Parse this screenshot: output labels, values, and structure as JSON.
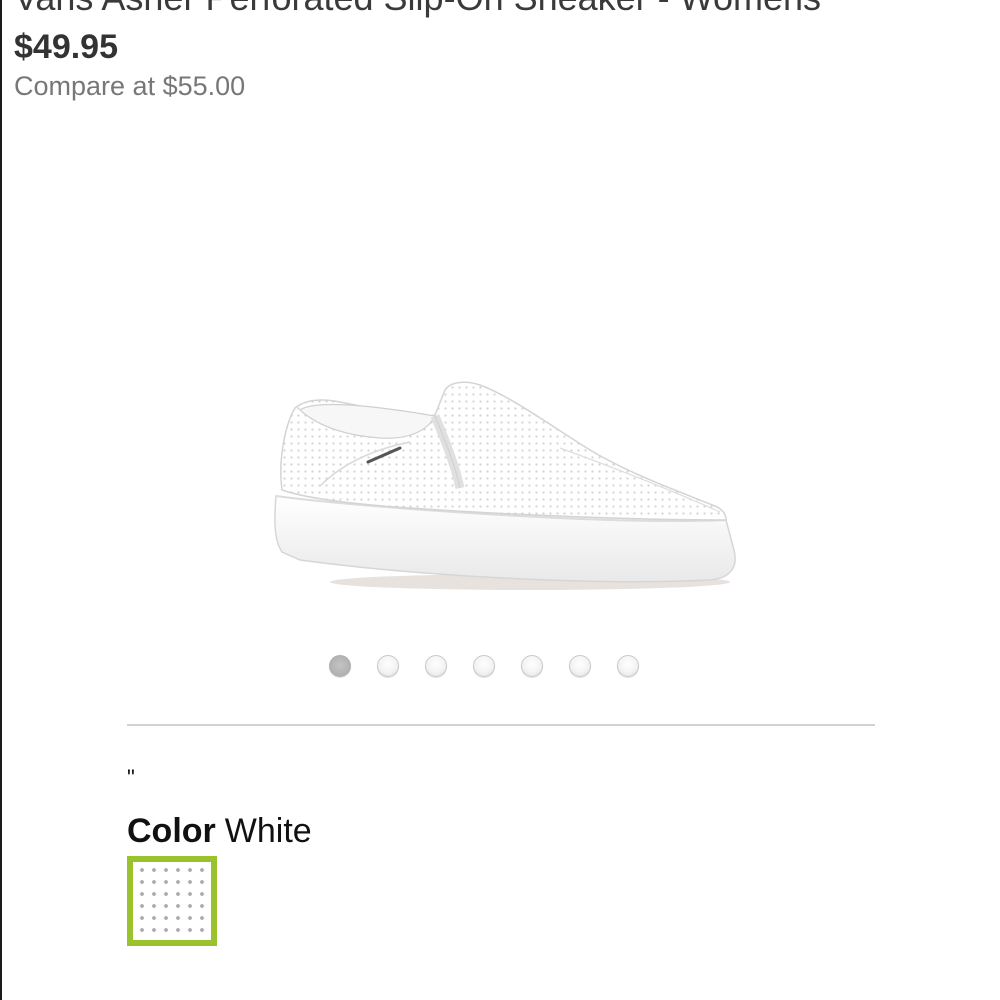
{
  "product": {
    "title": "Vans Asher Perforated Slip-On Sneaker - Womens",
    "price": "$49.95",
    "compare_label": "Compare at",
    "compare_price": "$55.00"
  },
  "image": {
    "subject": "white perforated slip-on sneaker"
  },
  "carousel": {
    "total": 7,
    "active_index": 0
  },
  "stray_mark": "\"",
  "color": {
    "label": "Color",
    "value": "White",
    "swatch_border": "#99c22c"
  },
  "colors": {
    "text": "#333333",
    "muted": "#777777",
    "divider": "#d2d2d2"
  }
}
